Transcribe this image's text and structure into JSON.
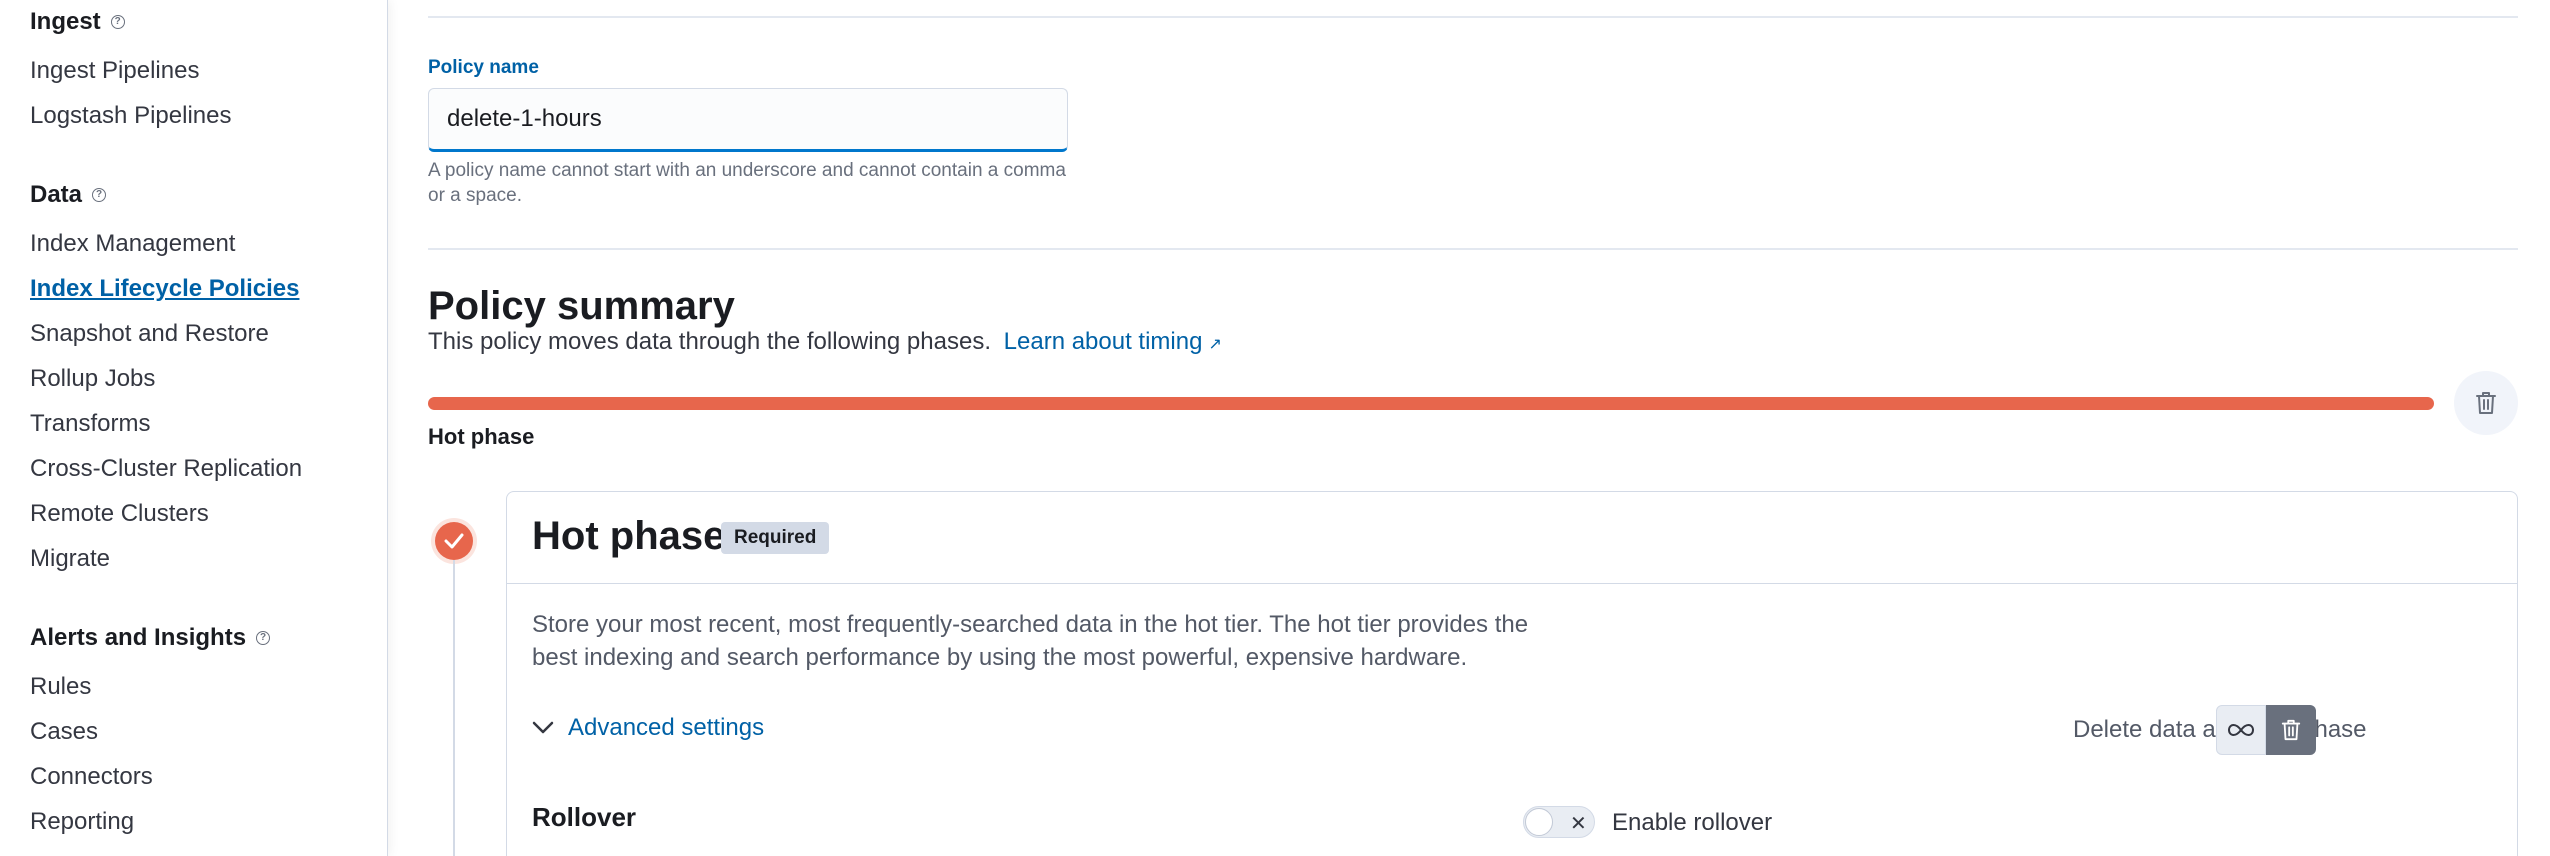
{
  "sidebar": {
    "sections": [
      {
        "title": "Ingest",
        "help_icon": "question-circle-icon",
        "items": [
          {
            "label": "Ingest Pipelines",
            "active": false
          },
          {
            "label": "Logstash Pipelines",
            "active": false
          }
        ]
      },
      {
        "title": "Data",
        "help_icon": "question-circle-icon",
        "items": [
          {
            "label": "Index Management",
            "active": false
          },
          {
            "label": "Index Lifecycle Policies",
            "active": true
          },
          {
            "label": "Snapshot and Restore",
            "active": false
          },
          {
            "label": "Rollup Jobs",
            "active": false
          },
          {
            "label": "Transforms",
            "active": false
          },
          {
            "label": "Cross-Cluster Replication",
            "active": false
          },
          {
            "label": "Remote Clusters",
            "active": false
          },
          {
            "label": "Migrate",
            "active": false
          }
        ]
      },
      {
        "title": "Alerts and Insights",
        "help_icon": "question-circle-icon",
        "items": [
          {
            "label": "Rules",
            "active": false
          },
          {
            "label": "Cases",
            "active": false
          },
          {
            "label": "Connectors",
            "active": false
          },
          {
            "label": "Reporting",
            "active": false
          }
        ]
      }
    ]
  },
  "form": {
    "policy_name_label": "Policy name",
    "policy_name_value": "delete-1-hours",
    "policy_name_help": "A policy name cannot start with an underscore and cannot contain a comma or a space."
  },
  "summary": {
    "title": "Policy summary",
    "description": "This policy moves data through the following phases.",
    "link_text": "Learn about timing",
    "phase_bar_label": "Hot phase",
    "phase_bar_color": "#e7664c"
  },
  "hot_phase": {
    "title": "Hot phase",
    "badge": "Required",
    "description": "Store your most recent, most frequently-searched data in the hot tier. The hot tier provides the best indexing and search performance by using the most powerful, expensive hardware.",
    "advanced_settings": "Advanced settings",
    "delete_label": "Delete data after this phase",
    "rollover_title": "Rollover",
    "rollover_toggle_label": "Enable rollover",
    "rollover_enabled": false
  },
  "colors": {
    "accent": "#0061a6",
    "hot": "#e7664c"
  }
}
